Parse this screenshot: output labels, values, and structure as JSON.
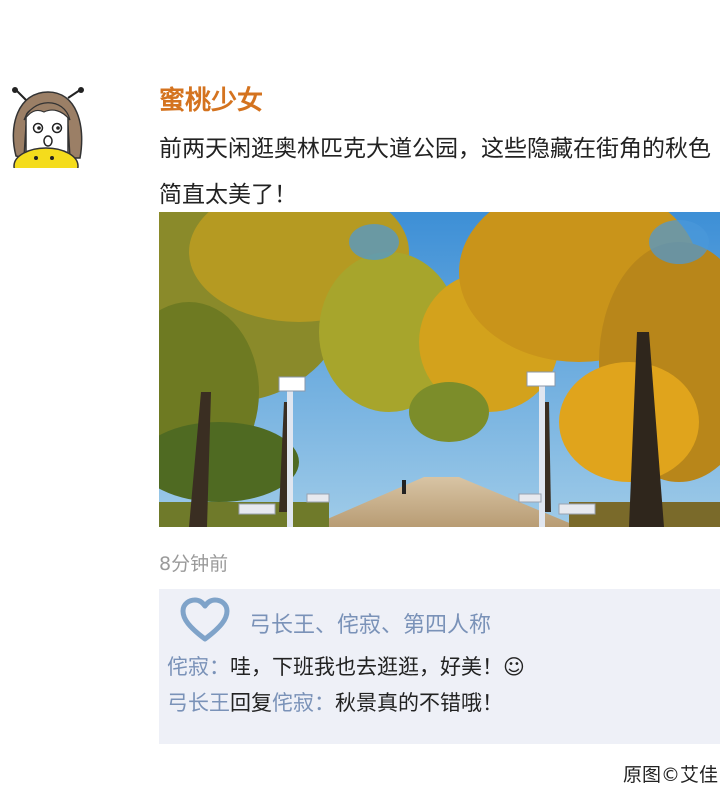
{
  "post": {
    "author": "蜜桃少女",
    "text": "前两天闲逛奥林匹克大道公园，这些隐藏在街角的秋色简直太美了！",
    "time": "8分钟前"
  },
  "likes": {
    "names": "弓长王、侘寂、第四人称"
  },
  "comments": [
    {
      "name": "侘寂",
      "sep": "：",
      "text": "哇，下班我也去逛逛，好美！☺"
    },
    {
      "name": "弓长王",
      "reply_word": "回复",
      "reply_to": "侘寂",
      "sep": "：",
      "text": "秋景真的不错哦！"
    }
  ],
  "credit": "原图©艾佳",
  "colors": {
    "author": "#d4731f",
    "name_link": "#7a92b8",
    "comment_bg": "#eef0f7",
    "heart": "#7fa3c9"
  },
  "icons": {
    "like": "heart-icon"
  }
}
